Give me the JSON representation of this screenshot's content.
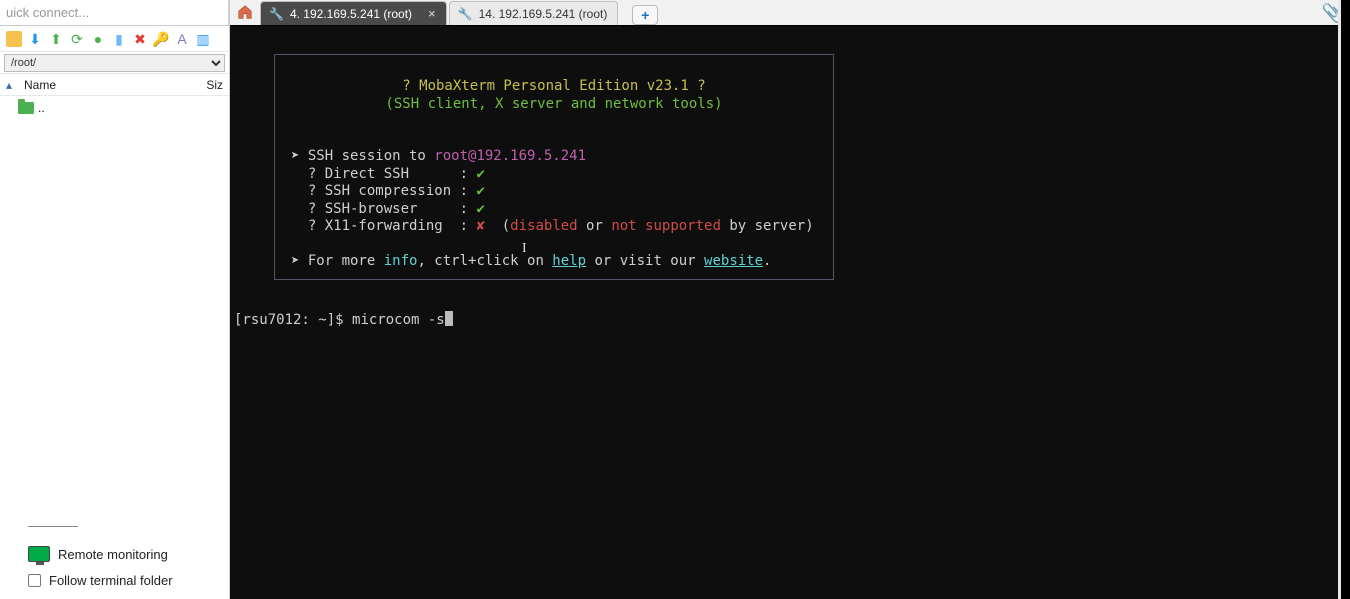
{
  "quickconnect_placeholder": "uick connect...",
  "sidebar": {
    "path": "/root/",
    "columns": {
      "name": "Name",
      "size": "Siz"
    },
    "updir_label": "..",
    "remote_monitoring": "Remote monitoring",
    "follow_terminal": "Follow terminal folder"
  },
  "tabs": [
    {
      "label": "4. 192.169.5.241 (root)",
      "active": true
    },
    {
      "label": "14. 192.169.5.241 (root)",
      "active": false
    }
  ],
  "banner": {
    "title": "? MobaXterm Personal Edition v23.1 ?",
    "subtitle": "(SSH client, X server and network tools)",
    "session_prefix": "SSH session to ",
    "session_target": "root@192.169.5.241",
    "direct_ssh": "? Direct SSH      : ",
    "ssh_compression": "? SSH compression : ",
    "ssh_browser": "? SSH-browser     : ",
    "x11": "? X11-forwarding  : ",
    "x11_disabled": "disabled",
    "x11_or": " or ",
    "x11_notsup": "not supported",
    "x11_byserver": " by server)",
    "info_prefix": "For more ",
    "info_word": "info",
    "info_mid": ", ctrl+click on ",
    "help_word": "help",
    "info_mid2": " or visit our ",
    "website_word": "website",
    "info_end": "."
  },
  "prompt": {
    "ps1": "[rsu7012: ~]$ ",
    "cmd": "microcom -s"
  }
}
